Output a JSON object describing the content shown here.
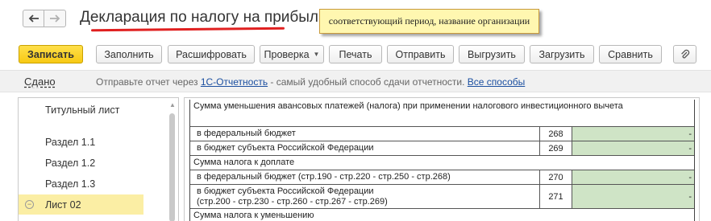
{
  "nav": {
    "back_icon": "arrow-left-icon",
    "forward_icon": "arrow-right-icon"
  },
  "header": {
    "title": "Декларация по налогу на прибыль за"
  },
  "annotation": {
    "text": "соответствующий период, название организации"
  },
  "toolbar": {
    "save": "Записать",
    "fill": "Заполнить",
    "decode": "Расшифровать",
    "check": "Проверка",
    "print": "Печать",
    "send": "Отправить",
    "export": "Выгрузить",
    "import": "Загрузить",
    "compare": "Сравнить",
    "attach_icon": "paperclip-icon"
  },
  "infobar": {
    "status": "Сдано",
    "text_before": "Отправьте отчет через ",
    "link_service": "1С-Отчетность",
    "text_after": " - самый удобный способ сдачи отчетности. ",
    "link_all": "Все способы"
  },
  "sections": [
    {
      "label": "Титульный лист"
    },
    {
      "label": "Раздел 1.1"
    },
    {
      "label": "Раздел 1.2"
    },
    {
      "label": "Раздел 1.3"
    },
    {
      "label": "Лист 02",
      "selected": true
    }
  ],
  "report": {
    "header_reduction": "Сумма уменьшения авансовых платежей (налога) при применении налогового инвестиционного вычета",
    "header_payable": "Сумма налога к доплате",
    "header_decrease": "Сумма налога к уменьшению",
    "rows": [
      {
        "label": "в федеральный бюджет",
        "code": "268",
        "value": "-"
      },
      {
        "label": "в бюджет субъекта Российской Федерации",
        "code": "269",
        "value": "-"
      },
      {
        "label": "в федеральный бюджет (стр.190 - стр.220 - стр.250 - стр.268)",
        "code": "270",
        "value": "-"
      },
      {
        "label": "в бюджет субъекта Российской Федерации",
        "label2": "(стр.200 - стр.230 - стр.260 - стр.267 - стр.269)",
        "code": "271",
        "value": "-"
      }
    ]
  },
  "colors": {
    "primary_button": "#f7c914",
    "highlight_selected": "#fbeea4",
    "input_cell": "#cfe4c6",
    "link": "#1b4fa0",
    "underline_mark": "#e02020",
    "annotation_bg": "#fff7b0"
  }
}
